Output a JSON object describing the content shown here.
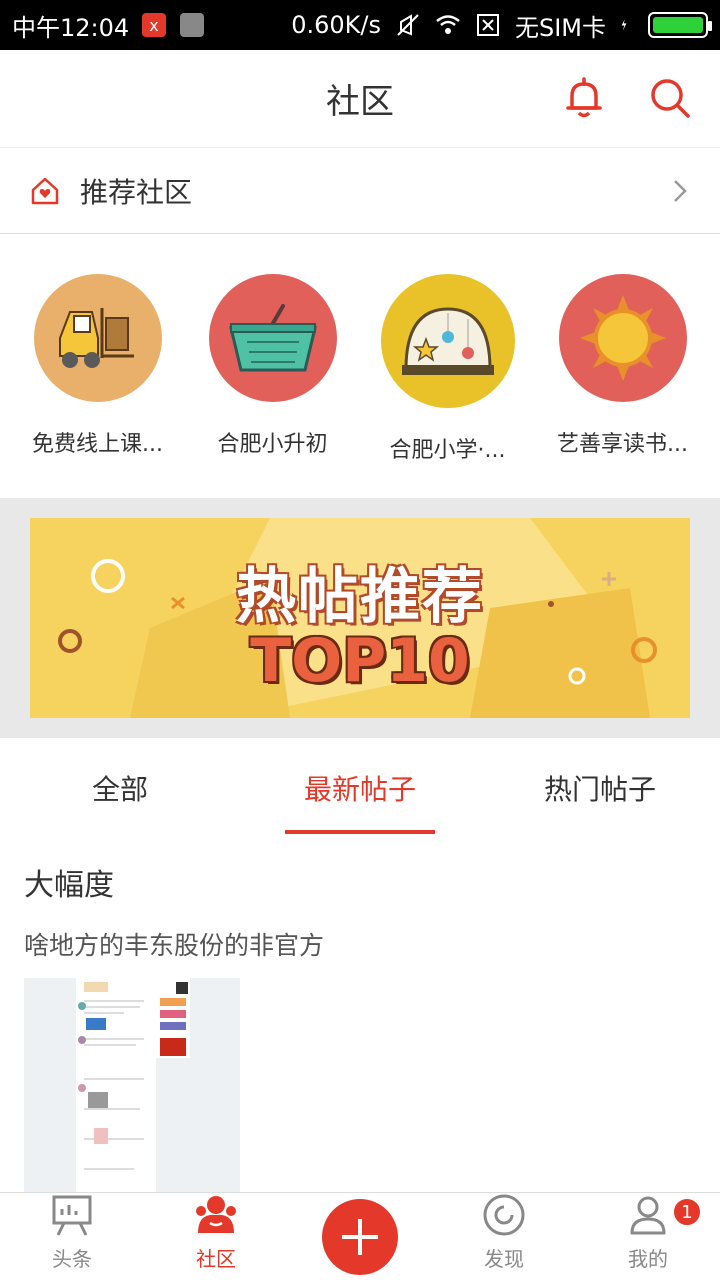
{
  "status_bar": {
    "time": "中午12:04",
    "speed": "0.60K/s",
    "sim": "无SIM卡"
  },
  "header": {
    "title": "社区"
  },
  "recommend": {
    "label": "推荐社区"
  },
  "communities": [
    {
      "label": "免费线上课...",
      "color": "#e8b06a"
    },
    {
      "label": "合肥小升初",
      "color": "#e2605a"
    },
    {
      "label": "合肥小学·...",
      "color": "#e9c22a"
    },
    {
      "label": "艺善享读书...",
      "color": "#e2605a"
    }
  ],
  "banner": {
    "title": "热帖推荐",
    "subtitle": "TOP10"
  },
  "tabs": [
    {
      "label": "全部"
    },
    {
      "label": "最新帖子"
    },
    {
      "label": "热门帖子"
    }
  ],
  "post": {
    "title": "大幅度",
    "body": "啥地方的丰东股份的非官方"
  },
  "bottom_nav": [
    {
      "label": "头条"
    },
    {
      "label": "社区"
    },
    {
      "label": ""
    },
    {
      "label": "发现"
    },
    {
      "label": "我的",
      "badge": "1"
    }
  ],
  "colors": {
    "accent": "#e4392a"
  }
}
